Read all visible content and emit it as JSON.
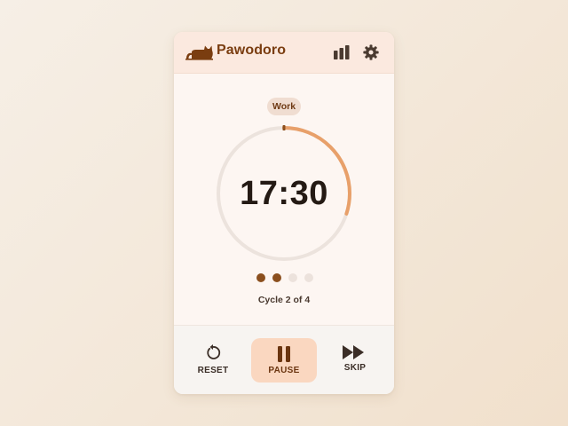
{
  "app": {
    "title": "Pawodoro",
    "logo_icon": "cat-icon",
    "stats_icon": "bar-chart-icon",
    "settings_icon": "gear-icon"
  },
  "timer": {
    "mode": "Work",
    "time": "17:30",
    "progress": 0.3,
    "cycle_label": "Cycle 2 of 4",
    "cycles_completed": 2,
    "cycles_total": 4
  },
  "controls": {
    "reset_label": "RESET",
    "reset_icon": "reset-icon",
    "pause_label": "PAUSE",
    "pause_icon": "pause-icon",
    "skip_label": "SKIP",
    "skip_icon": "skip-icon"
  },
  "colors": {
    "accent": "#e8a06a",
    "brand_text": "#7a3d10",
    "dot_active": "#8b4f1e",
    "dot_inactive": "#ece2dc",
    "ring_track": "#ece3dd"
  }
}
